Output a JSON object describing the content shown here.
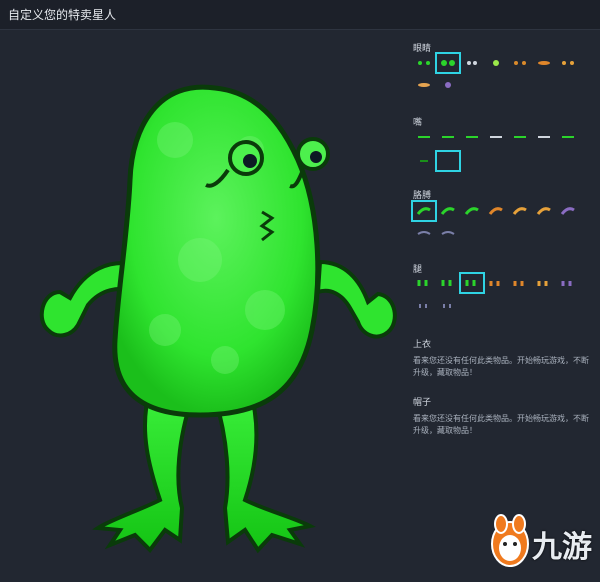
{
  "window": {
    "title": "自定义您的特卖星人"
  },
  "colors": {
    "accent": "#2fd3e3",
    "alien_green": "#2ee82e",
    "alien_outline": "#0a3b0a",
    "background": "#222731"
  },
  "sections": [
    {
      "title": "眼睛",
      "selected_index": 1,
      "item_count": 12
    },
    {
      "title": "嘴",
      "selected_index": 8,
      "item_count": 10
    },
    {
      "title": "胳膊",
      "selected_index": 0,
      "item_count": 8
    },
    {
      "title": "腿",
      "selected_index": 2,
      "item_count": 9
    },
    {
      "title": "上衣",
      "empty_text": "看来您还没有任何此类物品。开始畅玩游戏，不断升级，藏取物品！"
    },
    {
      "title": "帽子",
      "empty_text": "看来您还没有任何此类物品。开始畅玩游戏，不断升级，藏取物品！"
    }
  ],
  "logo": {
    "brand": "九游",
    "icon": "nine-game-mascot-icon"
  }
}
